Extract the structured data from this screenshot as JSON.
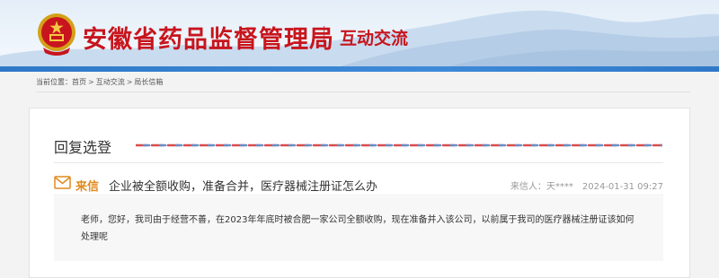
{
  "header": {
    "site_title": "安徽省药品监督管理局",
    "section_title": "互动交流",
    "brand_color": "#c8151d",
    "accent_color": "#2f78c8"
  },
  "breadcrumb": {
    "prefix": "当前位置：",
    "items": [
      "首页",
      "互动交流",
      "局长信箱"
    ],
    "separator": ">"
  },
  "panel": {
    "title": "回复选登"
  },
  "letter": {
    "icon": "envelope-icon",
    "tag": "来信",
    "subject": "企业被全额收购，准备合并，医疗器械注册证怎么办",
    "sender_label": "来信人：",
    "sender": "天****",
    "date": "2024-01-31 09:27",
    "content": "老师，您好，我司由于经营不善，在2023年年底时被合肥一家公司全额收购，现在准备并入该公司，以前属于我司的医疗器械注册证该如何处理呢"
  }
}
